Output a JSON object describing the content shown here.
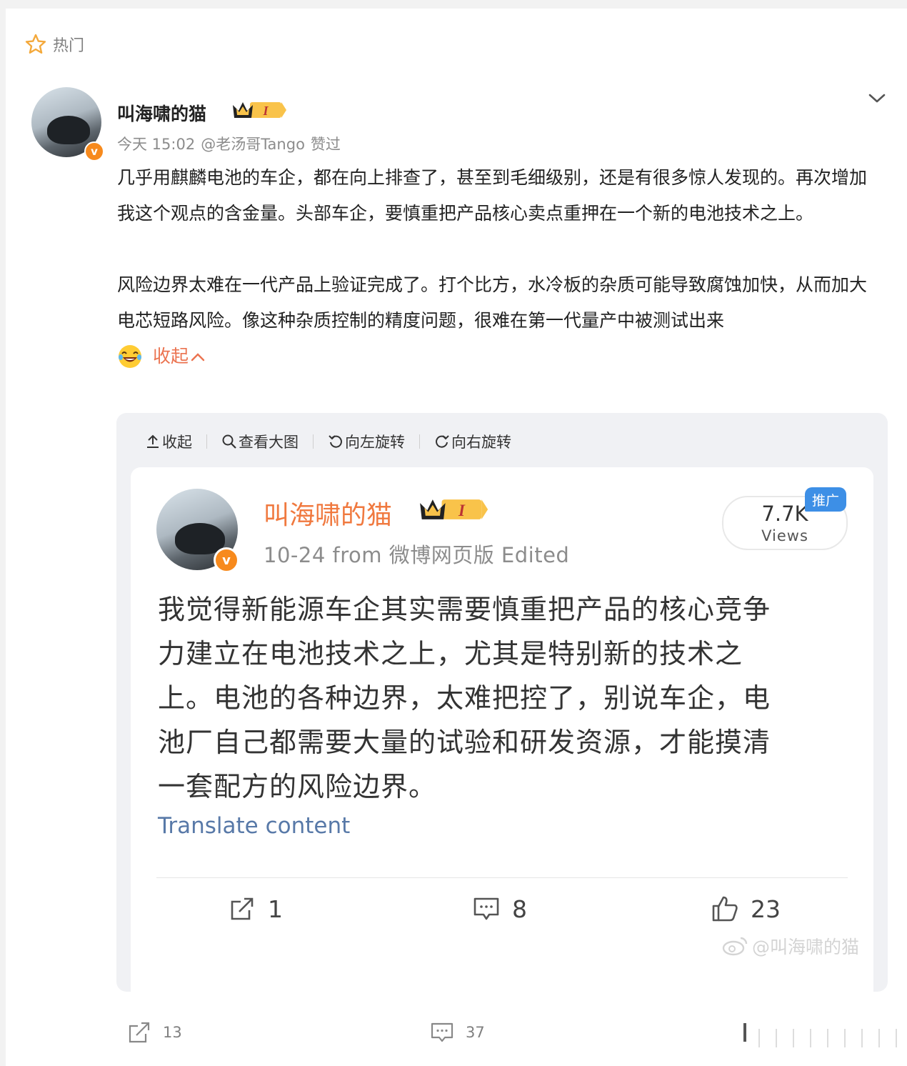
{
  "header": {
    "hot_label": "热门"
  },
  "post": {
    "author_name": "叫海啸的猫",
    "badge_level": "I",
    "meta_time": "今天 15:02",
    "meta_liked_by": "@老汤哥Tango",
    "meta_action": "赞过",
    "paragraphs": [
      "几乎用麒麟电池的车企，都在向上排查了，甚至到毛细级别，还是有很多惊人发现的。再次增加我这个观点的含金量。头部车企，要慎重把产品核心卖点重押在一个新的电池技术之上。",
      "风险边界太难在一代产品上验证完成了。打个比方，水冷板的杂质可能导致腐蚀加快，从而加大电芯短路风险。像这种杂质控制的精度问题，很难在第一代量产中被测试出来"
    ],
    "fold_label": "收起",
    "emoji_name": "laugh-cry-emoji"
  },
  "image_toolbar": {
    "collapse": "收起",
    "view_large": "查看大图",
    "rotate_left": "向左旋转",
    "rotate_right": "向右旋转"
  },
  "embedded_post": {
    "author_name": "叫海啸的猫",
    "badge_level": "I",
    "meta": "10-24  from 微博网页版  Edited",
    "views_count": "7.7K",
    "views_label": "Views",
    "promo_tag": "推广",
    "lines": [
      "我觉得新能源车企其实需要慎重把产品的核心竞争",
      "力建立在电池技术之上，尤其是特别新的技术之",
      "上。电池的各种边界，太难把控了，别说车企，电",
      "池厂自己都需要大量的试验和研发资源，才能摸清",
      "一套配方的风险边界。"
    ],
    "translate_label": "Translate content",
    "reposts": "1",
    "comments": "8",
    "likes": "23",
    "watermark": "@叫海啸的猫"
  },
  "actions": {
    "reposts": "13",
    "comments": "37"
  },
  "colors": {
    "accent_orange": "#eb7350",
    "name_orange": "#f0793f",
    "badge_orange": "#f78a1d",
    "link_blue": "#5879a8",
    "promo_blue": "#3d8fe6"
  }
}
